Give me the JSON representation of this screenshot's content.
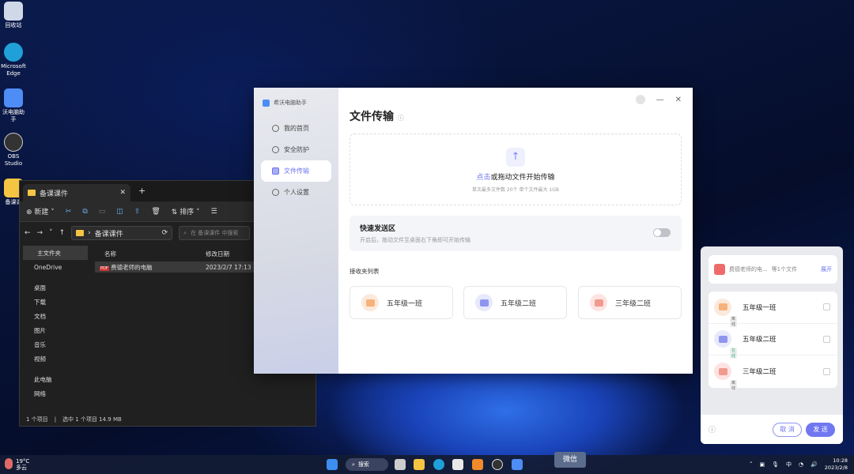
{
  "desktop": {
    "icons": [
      {
        "label": "回收站",
        "color": "#cfd8e6"
      },
      {
        "label": "Microsoft Edge",
        "color": "#1fa0d8"
      },
      {
        "label": "沃电脑助手",
        "color": "#4d8df5"
      },
      {
        "label": "OBS Studio",
        "color": "#333"
      },
      {
        "label": "备课课",
        "color": "#f4c542"
      }
    ]
  },
  "explorer": {
    "tab_title": "备课课件",
    "toolbar": {
      "new": "新建",
      "sort": "排序"
    },
    "address": "备课课件",
    "search_placeholder": "在 备课课件 中搜索",
    "nav": [
      "主文件夹",
      "OneDrive",
      "桌面",
      "下载",
      "文档",
      "图片",
      "音乐",
      "视频",
      "此电脑",
      "网络"
    ],
    "columns": [
      "名称",
      "修改日期"
    ],
    "files": [
      {
        "name": "费德老师的电脑",
        "date": "2023/2/7 17:13"
      }
    ],
    "status": [
      "1 个项目",
      "选中 1 个项目  14.9 MB"
    ]
  },
  "seewo": {
    "app_name": "希沃电脑助手",
    "nav": [
      {
        "label": "我的首页"
      },
      {
        "label": "安全防护"
      },
      {
        "label": "文件传输"
      },
      {
        "label": "个人设置"
      }
    ],
    "active_nav": "文件传输",
    "title": "文件传输",
    "drop": {
      "link": "点击",
      "text": "或拖动文件开始传输",
      "hint": "单次最多文件数 20个  单个文件最大 1GB"
    },
    "quick": {
      "title": "快速发送区",
      "desc": "开启后，拖动文件至桌面右下角即可开始传输",
      "enabled": false
    },
    "receivers_title": "接收夹列表",
    "receivers": [
      {
        "name": "五年级一班",
        "color": "#fbe9dc",
        "accent": "#f6b27a"
      },
      {
        "name": "五年级二班",
        "color": "#e8e9fb",
        "accent": "#8f95ef"
      },
      {
        "name": "三年级二班",
        "color": "#fde3e1",
        "accent": "#f19a90"
      }
    ]
  },
  "popup": {
    "file": "费德老师的电...",
    "count": "等1个文件",
    "expand": "展开",
    "rows": [
      {
        "name": "五年级一班",
        "status": "离线"
      },
      {
        "name": "五年级二班",
        "status": "在线"
      },
      {
        "name": "三年级二班",
        "status": "离线"
      }
    ],
    "cancel": "取 消",
    "send": "发 送"
  },
  "taskbar": {
    "weather_temp": "19°C",
    "weather_desc": "多云",
    "search": "搜索",
    "tooltip": "微信",
    "ime": "中",
    "time": "10:28",
    "date": "2023/2/8"
  }
}
